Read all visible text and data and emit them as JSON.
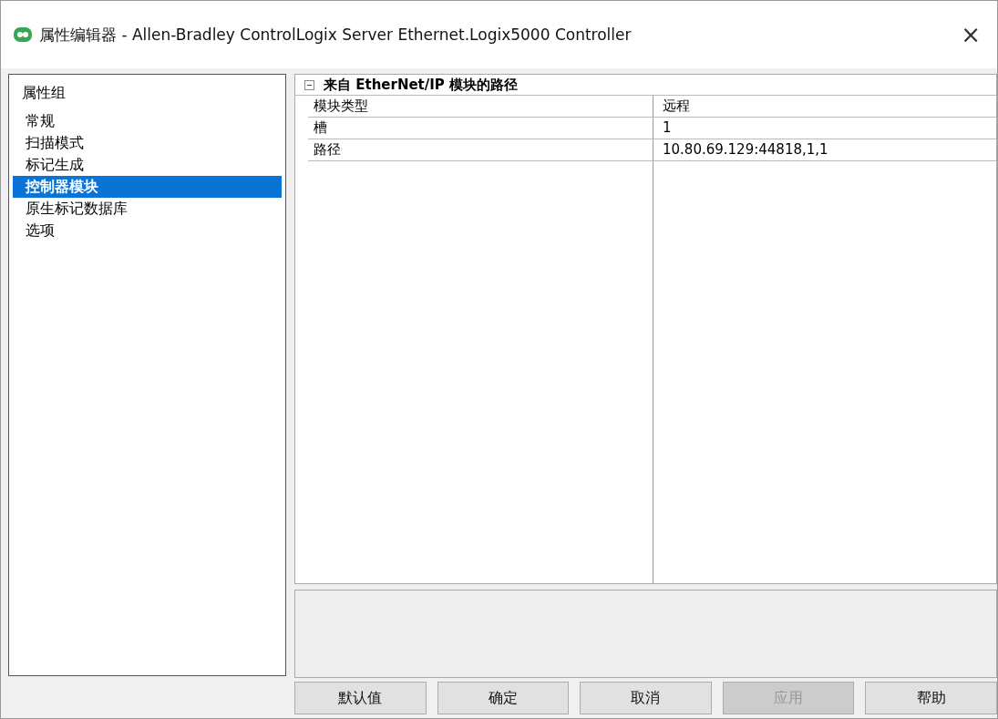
{
  "window": {
    "title": "属性编辑器 - Allen-Bradley ControlLogix Server Ethernet.Logix5000 Controller",
    "close": "×"
  },
  "sidebar": {
    "heading": "属性组",
    "items": [
      {
        "label": "常规",
        "selected": false
      },
      {
        "label": "扫描模式",
        "selected": false
      },
      {
        "label": "标记生成",
        "selected": false
      },
      {
        "label": "控制器模块",
        "selected": true
      },
      {
        "label": "原生标记数据库",
        "selected": false
      },
      {
        "label": "选项",
        "selected": false
      }
    ]
  },
  "property_grid": {
    "group": {
      "title": "来自 EtherNet/IP 模块的路径",
      "expanded": true
    },
    "rows": [
      {
        "name": "模块类型",
        "value": "远程"
      },
      {
        "name": "槽",
        "value": "1"
      },
      {
        "name": "路径",
        "value": "10.80.69.129:44818,1,1"
      }
    ]
  },
  "buttons": [
    {
      "label": "默认值",
      "disabled": false
    },
    {
      "label": "确定",
      "disabled": false
    },
    {
      "label": "取消",
      "disabled": false
    },
    {
      "label": "应用",
      "disabled": true
    },
    {
      "label": "帮助",
      "disabled": false
    }
  ]
}
